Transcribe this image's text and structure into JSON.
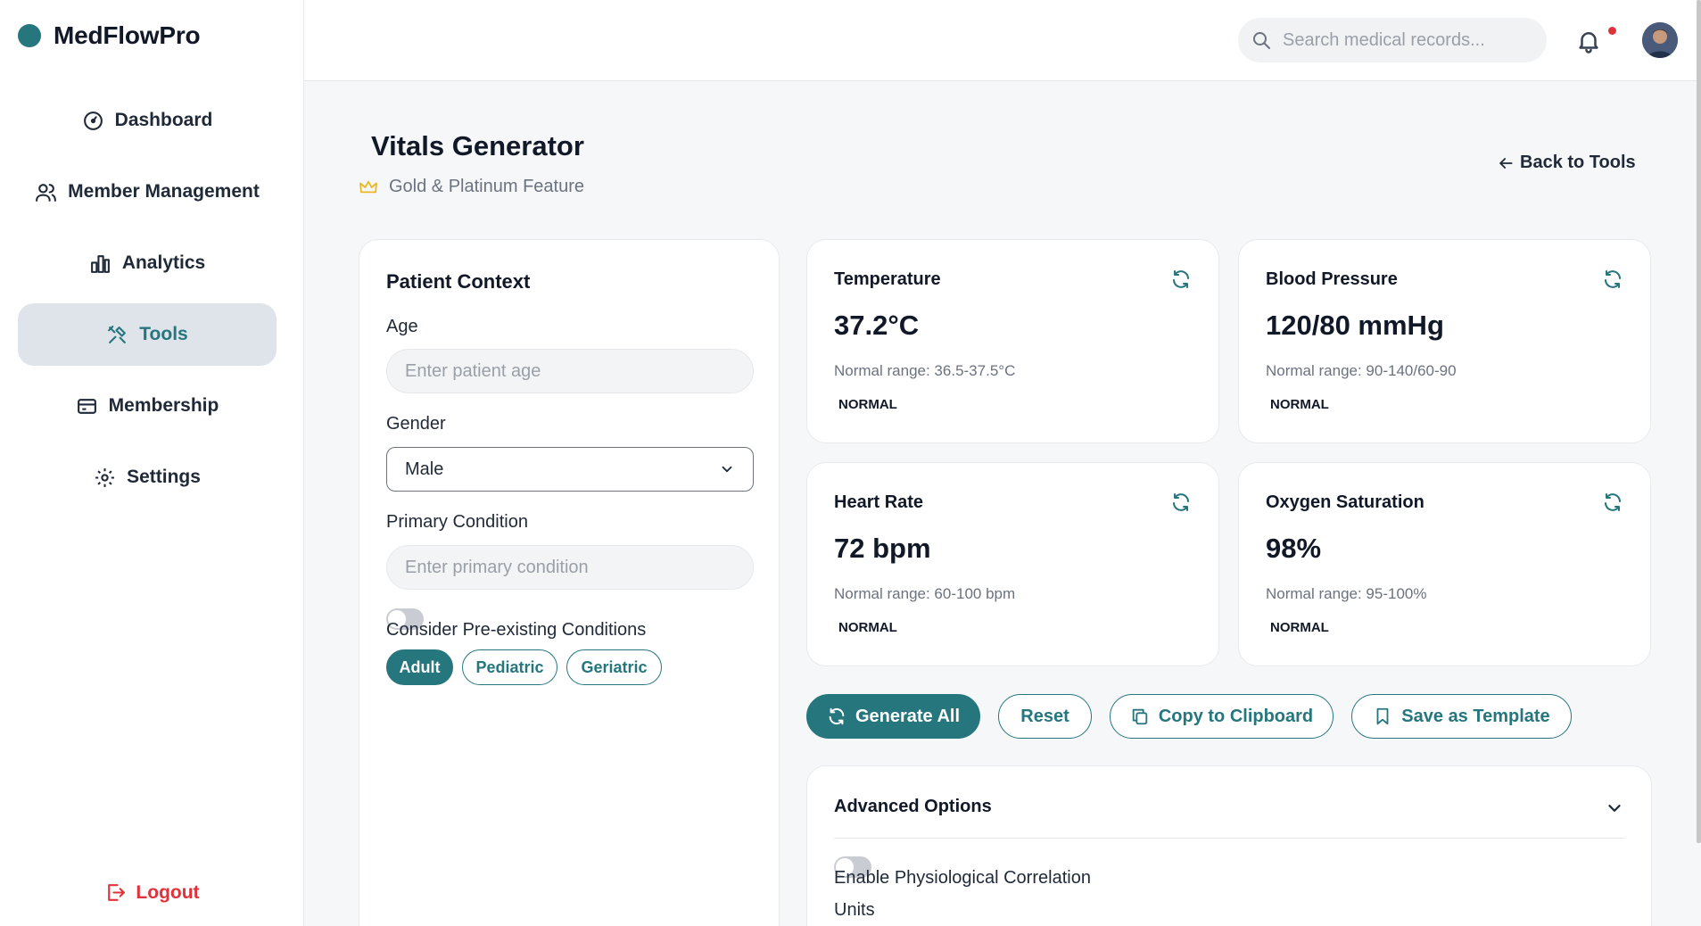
{
  "app": {
    "name": "MedFlowPro"
  },
  "colors": {
    "accent": "#26767e",
    "danger": "#e0323a",
    "active_nav_bg": "#dfe3ea"
  },
  "sidebar": {
    "items": [
      {
        "label": "Dashboard",
        "icon": "gauge-icon"
      },
      {
        "label": "Member Management",
        "icon": "users-icon"
      },
      {
        "label": "Analytics",
        "icon": "bar-chart-icon"
      },
      {
        "label": "Tools",
        "icon": "tools-icon",
        "active": true
      },
      {
        "label": "Membership",
        "icon": "card-icon"
      },
      {
        "label": "Settings",
        "icon": "gear-icon"
      }
    ],
    "logout": "Logout"
  },
  "topbar": {
    "search_placeholder": "Search medical records..."
  },
  "page": {
    "title": "Vitals Generator",
    "feature_badge": "Gold & Platinum Feature",
    "back": "Back to Tools"
  },
  "context": {
    "title": "Patient Context",
    "age_label": "Age",
    "age_placeholder": "Enter patient age",
    "gender_label": "Gender",
    "gender_value": "Male",
    "condition_label": "Primary Condition",
    "condition_placeholder": "Enter primary condition",
    "preexisting_label": "Consider Pre-existing Conditions",
    "preexisting_enabled": false,
    "age_groups": [
      "Adult",
      "Pediatric",
      "Geriatric"
    ],
    "selected_age_group": "Adult"
  },
  "vitals": [
    {
      "name": "Temperature",
      "value": "37.2°C",
      "range": "Normal range: 36.5-37.5°C",
      "status": "NORMAL"
    },
    {
      "name": "Blood Pressure",
      "value": "120/80 mmHg",
      "range": "Normal range: 90-140/60-90",
      "status": "NORMAL"
    },
    {
      "name": "Heart Rate",
      "value": "72 bpm",
      "range": "Normal range: 60-100 bpm",
      "status": "NORMAL"
    },
    {
      "name": "Oxygen Saturation",
      "value": "98%",
      "range": "Normal range: 95-100%",
      "status": "NORMAL"
    }
  ],
  "actions": {
    "generate_all": "Generate All",
    "reset": "Reset",
    "copy": "Copy to Clipboard",
    "save_template": "Save as Template"
  },
  "advanced": {
    "title": "Advanced Options",
    "correlation_label": "Enable Physiological Correlation",
    "correlation_enabled": false,
    "units_label": "Units"
  }
}
